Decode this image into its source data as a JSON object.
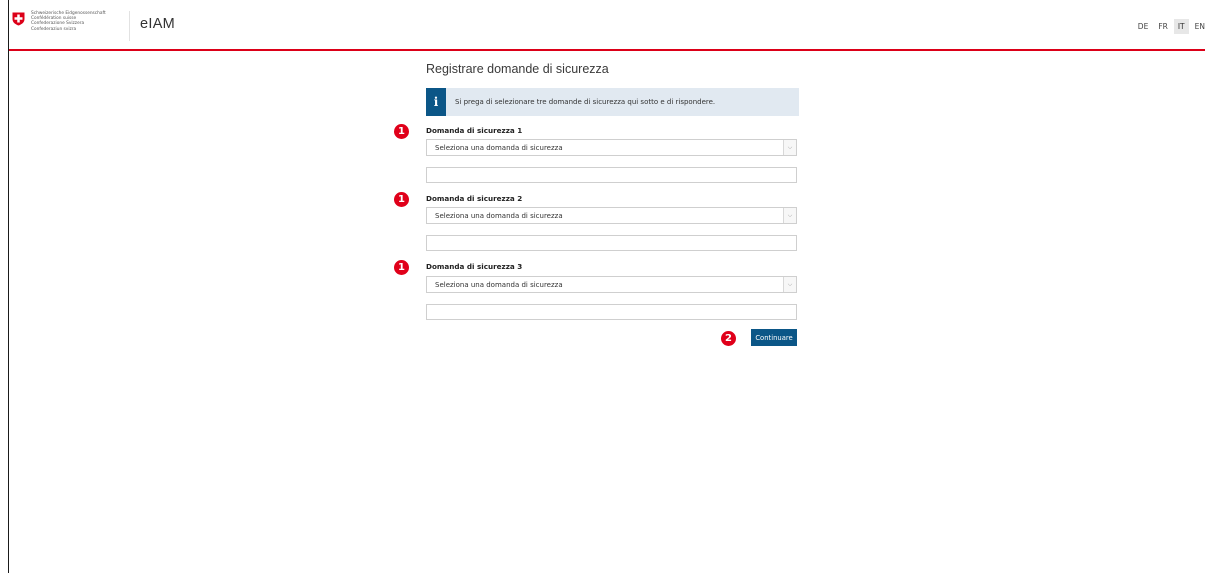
{
  "header": {
    "confederation_lines": [
      "Schweizerische Eidgenossenschaft",
      "Confédération suisse",
      "Confederazione Svizzera",
      "Confederaziun svizra"
    ],
    "app_name": "eIAM",
    "languages": [
      {
        "code": "DE",
        "active": false
      },
      {
        "code": "FR",
        "active": false
      },
      {
        "code": "IT",
        "active": true
      },
      {
        "code": "EN",
        "active": false
      }
    ]
  },
  "main": {
    "title": "Registrare domande di sicurezza",
    "info_icon": "i",
    "info_text": "Si prega di selezionare tre domande di sicurezza qui sotto e di rispondere.",
    "questions": [
      {
        "label": "Domanda di sicurezza 1",
        "select_value": "Seleziona una domanda di sicurezza",
        "answer_value": ""
      },
      {
        "label": "Domanda di sicurezza 2",
        "select_value": "Seleziona una domanda di sicurezza",
        "answer_value": ""
      },
      {
        "label": "Domanda di sicurezza 3",
        "select_value": "Seleziona una domanda di sicurezza",
        "answer_value": ""
      }
    ],
    "continue_label": "Continuare"
  },
  "annotations": {
    "step_1": "1",
    "step_2": "2"
  },
  "colors": {
    "accent_red": "#dc0018",
    "primary_blue": "#0b5687",
    "info_bg": "#e1e9f1"
  },
  "icons": {
    "flag": "swiss-cross-icon",
    "info": "info-icon",
    "dropdown": "chevron-down-icon"
  }
}
